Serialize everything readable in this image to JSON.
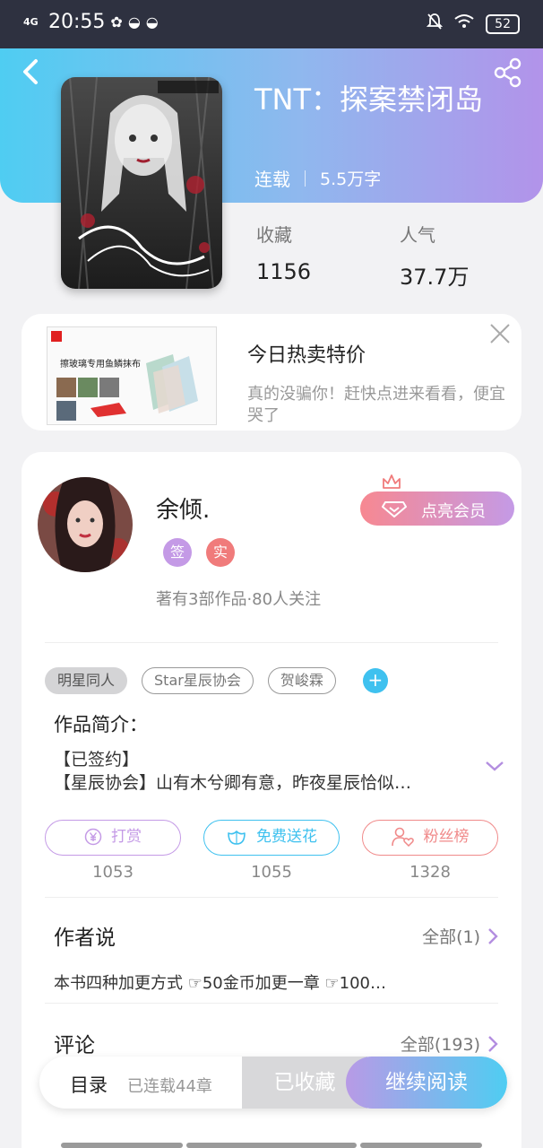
{
  "status_bar": {
    "network": "4G",
    "time": "20:55",
    "battery": "52"
  },
  "book": {
    "title": "TNT：探案禁闭岛",
    "status": "连载",
    "word_count": "5.5万字",
    "favorites_label": "收藏",
    "favorites_value": "1156",
    "popularity_label": "人气",
    "popularity_value": "37.7万"
  },
  "ad": {
    "title": "今日热卖特价",
    "description": "真的没骗你！赶快点进来看看，便宜哭了",
    "image_caption": "擦玻璃专用鱼鳞抹布"
  },
  "author": {
    "name": "余倾.",
    "badge_signed": "签",
    "badge_real": "实",
    "stats": "著有3部作品·80人关注",
    "vip_button": "点亮会员"
  },
  "tags": [
    "明星同人",
    "Star星辰协会",
    "贺峻霖"
  ],
  "intro": {
    "label": "作品简介：",
    "line1": "【已签约】",
    "line2": "【星辰协会】山有木兮卿有意，昨夜星辰恰似…"
  },
  "actions": [
    {
      "label": "打赏",
      "count": "1053",
      "color": "#c49ae6"
    },
    {
      "label": "免费送花",
      "count": "1055",
      "color": "#3fc1ef"
    },
    {
      "label": "粉丝榜",
      "count": "1328",
      "color": "#f08a8a"
    }
  ],
  "author_says": {
    "title": "作者说",
    "link": "全部(1)",
    "text": "本书四种加更方式 ☞50金币加更一章 ☞100…"
  },
  "comments": {
    "title": "评论",
    "link": "全部(193)"
  },
  "bottom_bar": {
    "directory": "目录",
    "chapter_count": "已连载44章",
    "collected": "已收藏",
    "continue": "继续阅读"
  }
}
